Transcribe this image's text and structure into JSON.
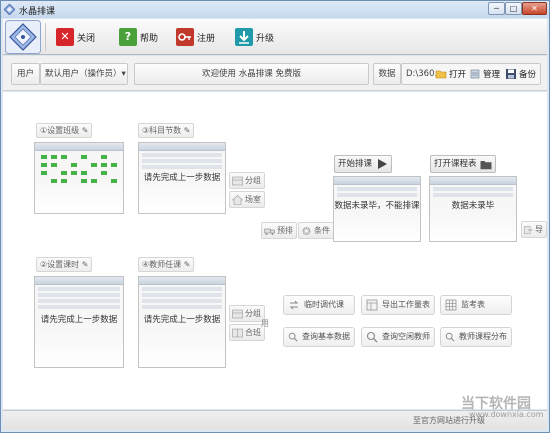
{
  "window": {
    "title": "水晶排课",
    "min": "─",
    "max": "□",
    "close": "✕"
  },
  "toolbar": {
    "close_label": "关闭",
    "help_label": "帮助",
    "register_label": "注册",
    "upgrade_label": "升级"
  },
  "controlbar": {
    "user_label": "用户",
    "user_value": "默认用户（操作员）",
    "welcome": "欢迎使用 水晶排课 免费版",
    "data_label": "数据",
    "data_path": "D:\\360...",
    "open_label": "打开",
    "manage_label": "管理",
    "backup_label": "备份"
  },
  "steps": {
    "set_class": "①设置班级",
    "subject_periods": "③科目节数",
    "set_lessons": "②设置课时",
    "teacher_assign": "④教师任课",
    "start_schedule": "开始排课",
    "open_schedule": "打开课程表"
  },
  "messages": {
    "prev_step_1": "请先完成上一步数据",
    "prev_step_2": "请先完成上一步数据",
    "prev_step_3": "请先完成上一步数据",
    "no_input_no_schedule": "数据未录毕，不能排课",
    "data_not_entered": "数据未录毕"
  },
  "side": {
    "group_1": "分组",
    "venue": "场室",
    "pre_schedule": "预排",
    "conditions": "条件",
    "group_2": "分组",
    "merge_class": "合班",
    "use_label": "用",
    "export_cut": "导"
  },
  "utilities": {
    "temp_adjust": "临时调代课",
    "export_workload": "导出工作量表",
    "exam_table": "监考表",
    "query_basic": "查询基本数据",
    "query_free_teacher": "查询空闲教师",
    "teacher_course_dist": "教师课程分布"
  },
  "status": {
    "text": "至官方网站进行升级"
  },
  "watermark": {
    "brand": "当下软件园",
    "url": "www.downxia.com"
  },
  "colors": {
    "close_red": "#d7262b",
    "help_green": "#4aa13a",
    "register_red": "#c0392b",
    "upgrade_teal": "#1f9aa8",
    "green_cell": "#44b244"
  }
}
